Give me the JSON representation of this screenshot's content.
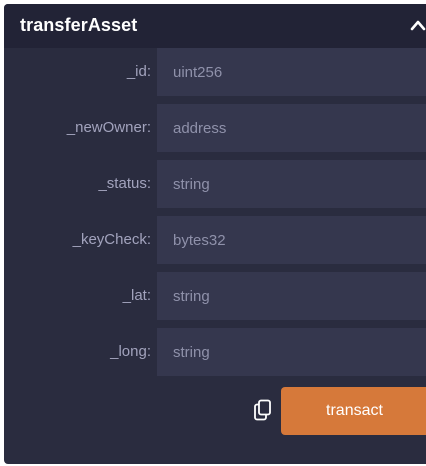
{
  "function": {
    "name": "transferAsset"
  },
  "icons": {
    "collapse": "chevron-up-icon",
    "copy": "copy-icon"
  },
  "params": [
    {
      "label": "_id:",
      "placeholder": "uint256"
    },
    {
      "label": "_newOwner:",
      "placeholder": "address"
    },
    {
      "label": "_status:",
      "placeholder": "string"
    },
    {
      "label": "_keyCheck:",
      "placeholder": "bytes32"
    },
    {
      "label": "_lat:",
      "placeholder": "string"
    },
    {
      "label": "_long:",
      "placeholder": "string"
    }
  ],
  "actions": {
    "transact_label": "transact"
  },
  "colors": {
    "panel_bg": "#2a2c3f",
    "header_bg": "#222336",
    "input_bg": "#35374e",
    "accent": "#d6793a"
  }
}
